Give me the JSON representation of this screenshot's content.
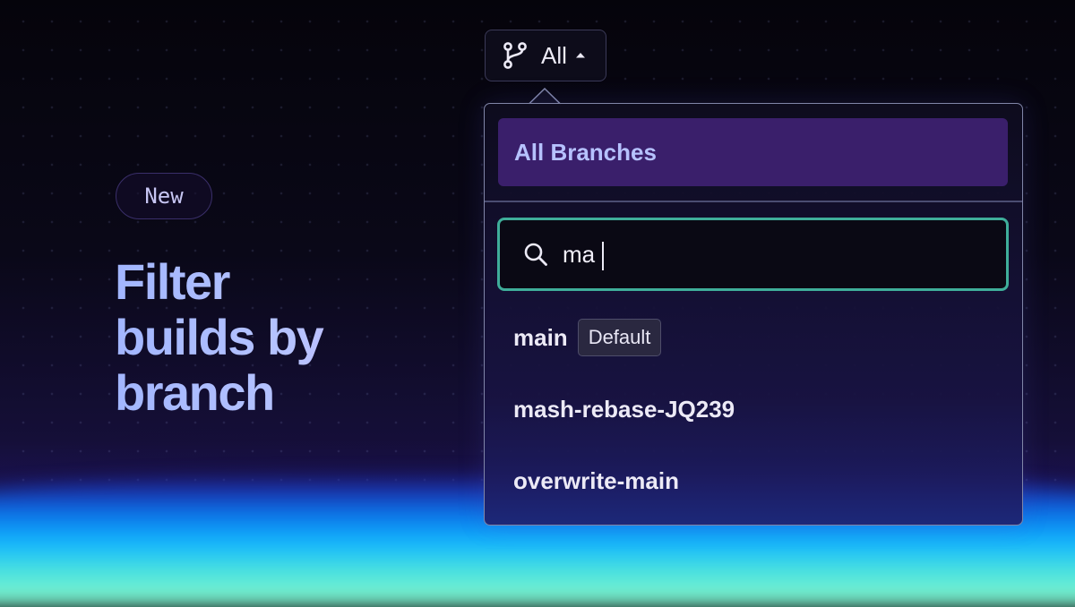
{
  "badge": {
    "label": "New"
  },
  "headline": {
    "line1": "Filter",
    "line2": "builds by",
    "line3": "branch"
  },
  "trigger": {
    "label": "All",
    "icon": "git-branch-icon",
    "caret": "caret-up-icon"
  },
  "dropdown": {
    "selected_option": "All Branches",
    "search": {
      "value": "ma",
      "icon": "search-icon"
    },
    "results": [
      {
        "name": "main",
        "badge": "Default"
      },
      {
        "name": "mash-rebase-JQ239"
      },
      {
        "name": "overwrite-main"
      }
    ]
  },
  "colors": {
    "accent_highlight": "#3a1f6b",
    "focus_ring": "#3fae9a",
    "headline": "#a6b9ff"
  }
}
